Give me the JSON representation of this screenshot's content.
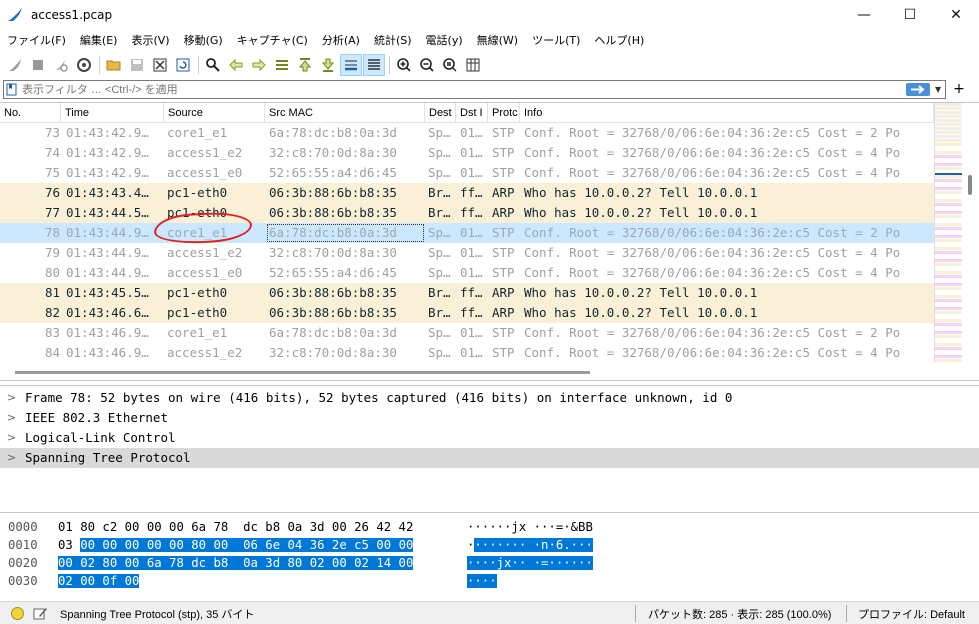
{
  "window": {
    "title": "access1.pcap",
    "minimize": "—",
    "maximize": "☐",
    "close": "✕"
  },
  "menu": [
    "ファイル(F)",
    "編集(E)",
    "表示(V)",
    "移動(G)",
    "キャプチャ(C)",
    "分析(A)",
    "統計(S)",
    "電話(y)",
    "無線(W)",
    "ツール(T)",
    "ヘルプ(H)"
  ],
  "toolbar": {
    "icons": [
      "shark-fin-start-icon",
      "stop-icon",
      "restart-icon",
      "options-gear-icon",
      "open-folder-icon",
      "save-file-icon",
      "close-file-icon",
      "reload-icon",
      "find-magnifier-icon",
      "back-arrow-icon",
      "forward-arrow-icon",
      "goto-packet-icon",
      "first-packet-icon",
      "last-packet-icon",
      "autoscroll-icon",
      "colorize-icon",
      "zoom-in-icon",
      "zoom-out-icon",
      "zoom-reset-icon",
      "resize-columns-icon"
    ]
  },
  "filter": {
    "placeholder": "表示フィルタ … <Ctrl-/> を適用",
    "value": "",
    "plus": "+"
  },
  "columns": [
    "No.",
    "Time",
    "Source",
    "Src MAC",
    "Dest",
    "Dst I",
    "Protc",
    "Info"
  ],
  "packets": [
    {
      "no": "73",
      "time": "01:43:42.9…",
      "source": "core1_e1",
      "srcmac": "6a:78:dc:b8:0a:3d",
      "dest": "Sp…",
      "dsti": "01…",
      "proto": "STP",
      "info": "Conf. Root = 32768/0/06:6e:04:36:2e:c5  Cost = 2  Po",
      "kind": "stp"
    },
    {
      "no": "74",
      "time": "01:43:42.9…",
      "source": "access1_e2",
      "srcmac": "32:c8:70:0d:8a:30",
      "dest": "Sp…",
      "dsti": "01…",
      "proto": "STP",
      "info": "Conf. Root = 32768/0/06:6e:04:36:2e:c5  Cost = 4  Po",
      "kind": "stp"
    },
    {
      "no": "75",
      "time": "01:43:42.9…",
      "source": "access1_e0",
      "srcmac": "52:65:55:a4:d6:45",
      "dest": "Sp…",
      "dsti": "01…",
      "proto": "STP",
      "info": "Conf. Root = 32768/0/06:6e:04:36:2e:c5  Cost = 4  Po",
      "kind": "stp"
    },
    {
      "no": "76",
      "time": "01:43:43.4…",
      "source": "pc1-eth0",
      "srcmac": "06:3b:88:6b:b8:35",
      "dest": "Br…",
      "dsti": "ff…",
      "proto": "ARP",
      "info": "Who has 10.0.0.2? Tell 10.0.0.1",
      "kind": "arp"
    },
    {
      "no": "77",
      "time": "01:43:44.5…",
      "source": "pc1-eth0",
      "srcmac": "06:3b:88:6b:b8:35",
      "dest": "Br…",
      "dsti": "ff…",
      "proto": "ARP",
      "info": "Who has 10.0.0.2? Tell 10.0.0.1",
      "kind": "arp"
    },
    {
      "no": "78",
      "time": "01:43:44.9…",
      "source": "core1_e1",
      "srcmac": "6a:78:dc:b8:0a:3d",
      "dest": "Sp…",
      "dsti": "01…",
      "proto": "STP",
      "info": "Conf. Root = 32768/0/06:6e:04:36:2e:c5  Cost = 2  Po",
      "kind": "selected"
    },
    {
      "no": "79",
      "time": "01:43:44.9…",
      "source": "access1_e2",
      "srcmac": "32:c8:70:0d:8a:30",
      "dest": "Sp…",
      "dsti": "01…",
      "proto": "STP",
      "info": "Conf. Root = 32768/0/06:6e:04:36:2e:c5  Cost = 4  Po",
      "kind": "stp"
    },
    {
      "no": "80",
      "time": "01:43:44.9…",
      "source": "access1_e0",
      "srcmac": "52:65:55:a4:d6:45",
      "dest": "Sp…",
      "dsti": "01…",
      "proto": "STP",
      "info": "Conf. Root = 32768/0/06:6e:04:36:2e:c5  Cost = 4  Po",
      "kind": "stp"
    },
    {
      "no": "81",
      "time": "01:43:45.5…",
      "source": "pc1-eth0",
      "srcmac": "06:3b:88:6b:b8:35",
      "dest": "Br…",
      "dsti": "ff…",
      "proto": "ARP",
      "info": "Who has 10.0.0.2? Tell 10.0.0.1",
      "kind": "arp"
    },
    {
      "no": "82",
      "time": "01:43:46.6…",
      "source": "pc1-eth0",
      "srcmac": "06:3b:88:6b:b8:35",
      "dest": "Br…",
      "dsti": "ff…",
      "proto": "ARP",
      "info": "Who has 10.0.0.2? Tell 10.0.0.1",
      "kind": "arp"
    },
    {
      "no": "83",
      "time": "01:43:46.9…",
      "source": "core1_e1",
      "srcmac": "6a:78:dc:b8:0a:3d",
      "dest": "Sp…",
      "dsti": "01…",
      "proto": "STP",
      "info": "Conf. Root = 32768/0/06:6e:04:36:2e:c5  Cost = 2  Po",
      "kind": "stp"
    },
    {
      "no": "84",
      "time": "01:43:46.9…",
      "source": "access1_e2",
      "srcmac": "32:c8:70:0d:8a:30",
      "dest": "Sp…",
      "dsti": "01…",
      "proto": "STP",
      "info": "Conf. Root = 32768/0/06:6e:04:36:2e:c5  Cost = 4  Po",
      "kind": "stp"
    }
  ],
  "details": [
    {
      "label": "Frame 78: 52 bytes on wire (416 bits), 52 bytes captured (416 bits) on interface unknown, id 0",
      "highlight": false
    },
    {
      "label": "IEEE 802.3 Ethernet",
      "highlight": false
    },
    {
      "label": "Logical-Link Control",
      "highlight": false
    },
    {
      "label": "Spanning Tree Protocol",
      "highlight": true
    }
  ],
  "bytes": [
    {
      "offset": "0000",
      "hex_plain": "01 80 c2 00 00 00 6a 78  dc b8 0a 3d 00 26 42 42",
      "hex_sel": "",
      "ascii_plain": "······jx ···=·&BB",
      "ascii_sel": ""
    },
    {
      "offset": "0010",
      "hex_plain": "03 ",
      "hex_sel": "00 00 00 00 00 80 00  06 6e 04 36 2e c5 00 00",
      "ascii_plain": "·",
      "ascii_sel": "······· ·n·6.···"
    },
    {
      "offset": "0020",
      "hex_plain": "",
      "hex_sel": "00 02 80 00 6a 78 dc b8  0a 3d 80 02 00 02 14 00",
      "ascii_plain": "",
      "ascii_sel": "····jx·· ·=······"
    },
    {
      "offset": "0030",
      "hex_plain": "",
      "hex_sel": "02 00 0f 00",
      "ascii_plain": "",
      "ascii_sel": "····"
    }
  ],
  "status": {
    "protocol": "Spanning Tree Protocol (stp), 35 バイト",
    "packets": "パケット数: 285 · 表示: 285 (100.0%)",
    "profile": "プロファイル: Default"
  },
  "colors": {
    "arp_row": "#faf0d7",
    "stp_text": "#a0a0a0",
    "selected_row": "#cce8ff",
    "byte_selection": "#0078d7",
    "annotation": "#e02020"
  }
}
